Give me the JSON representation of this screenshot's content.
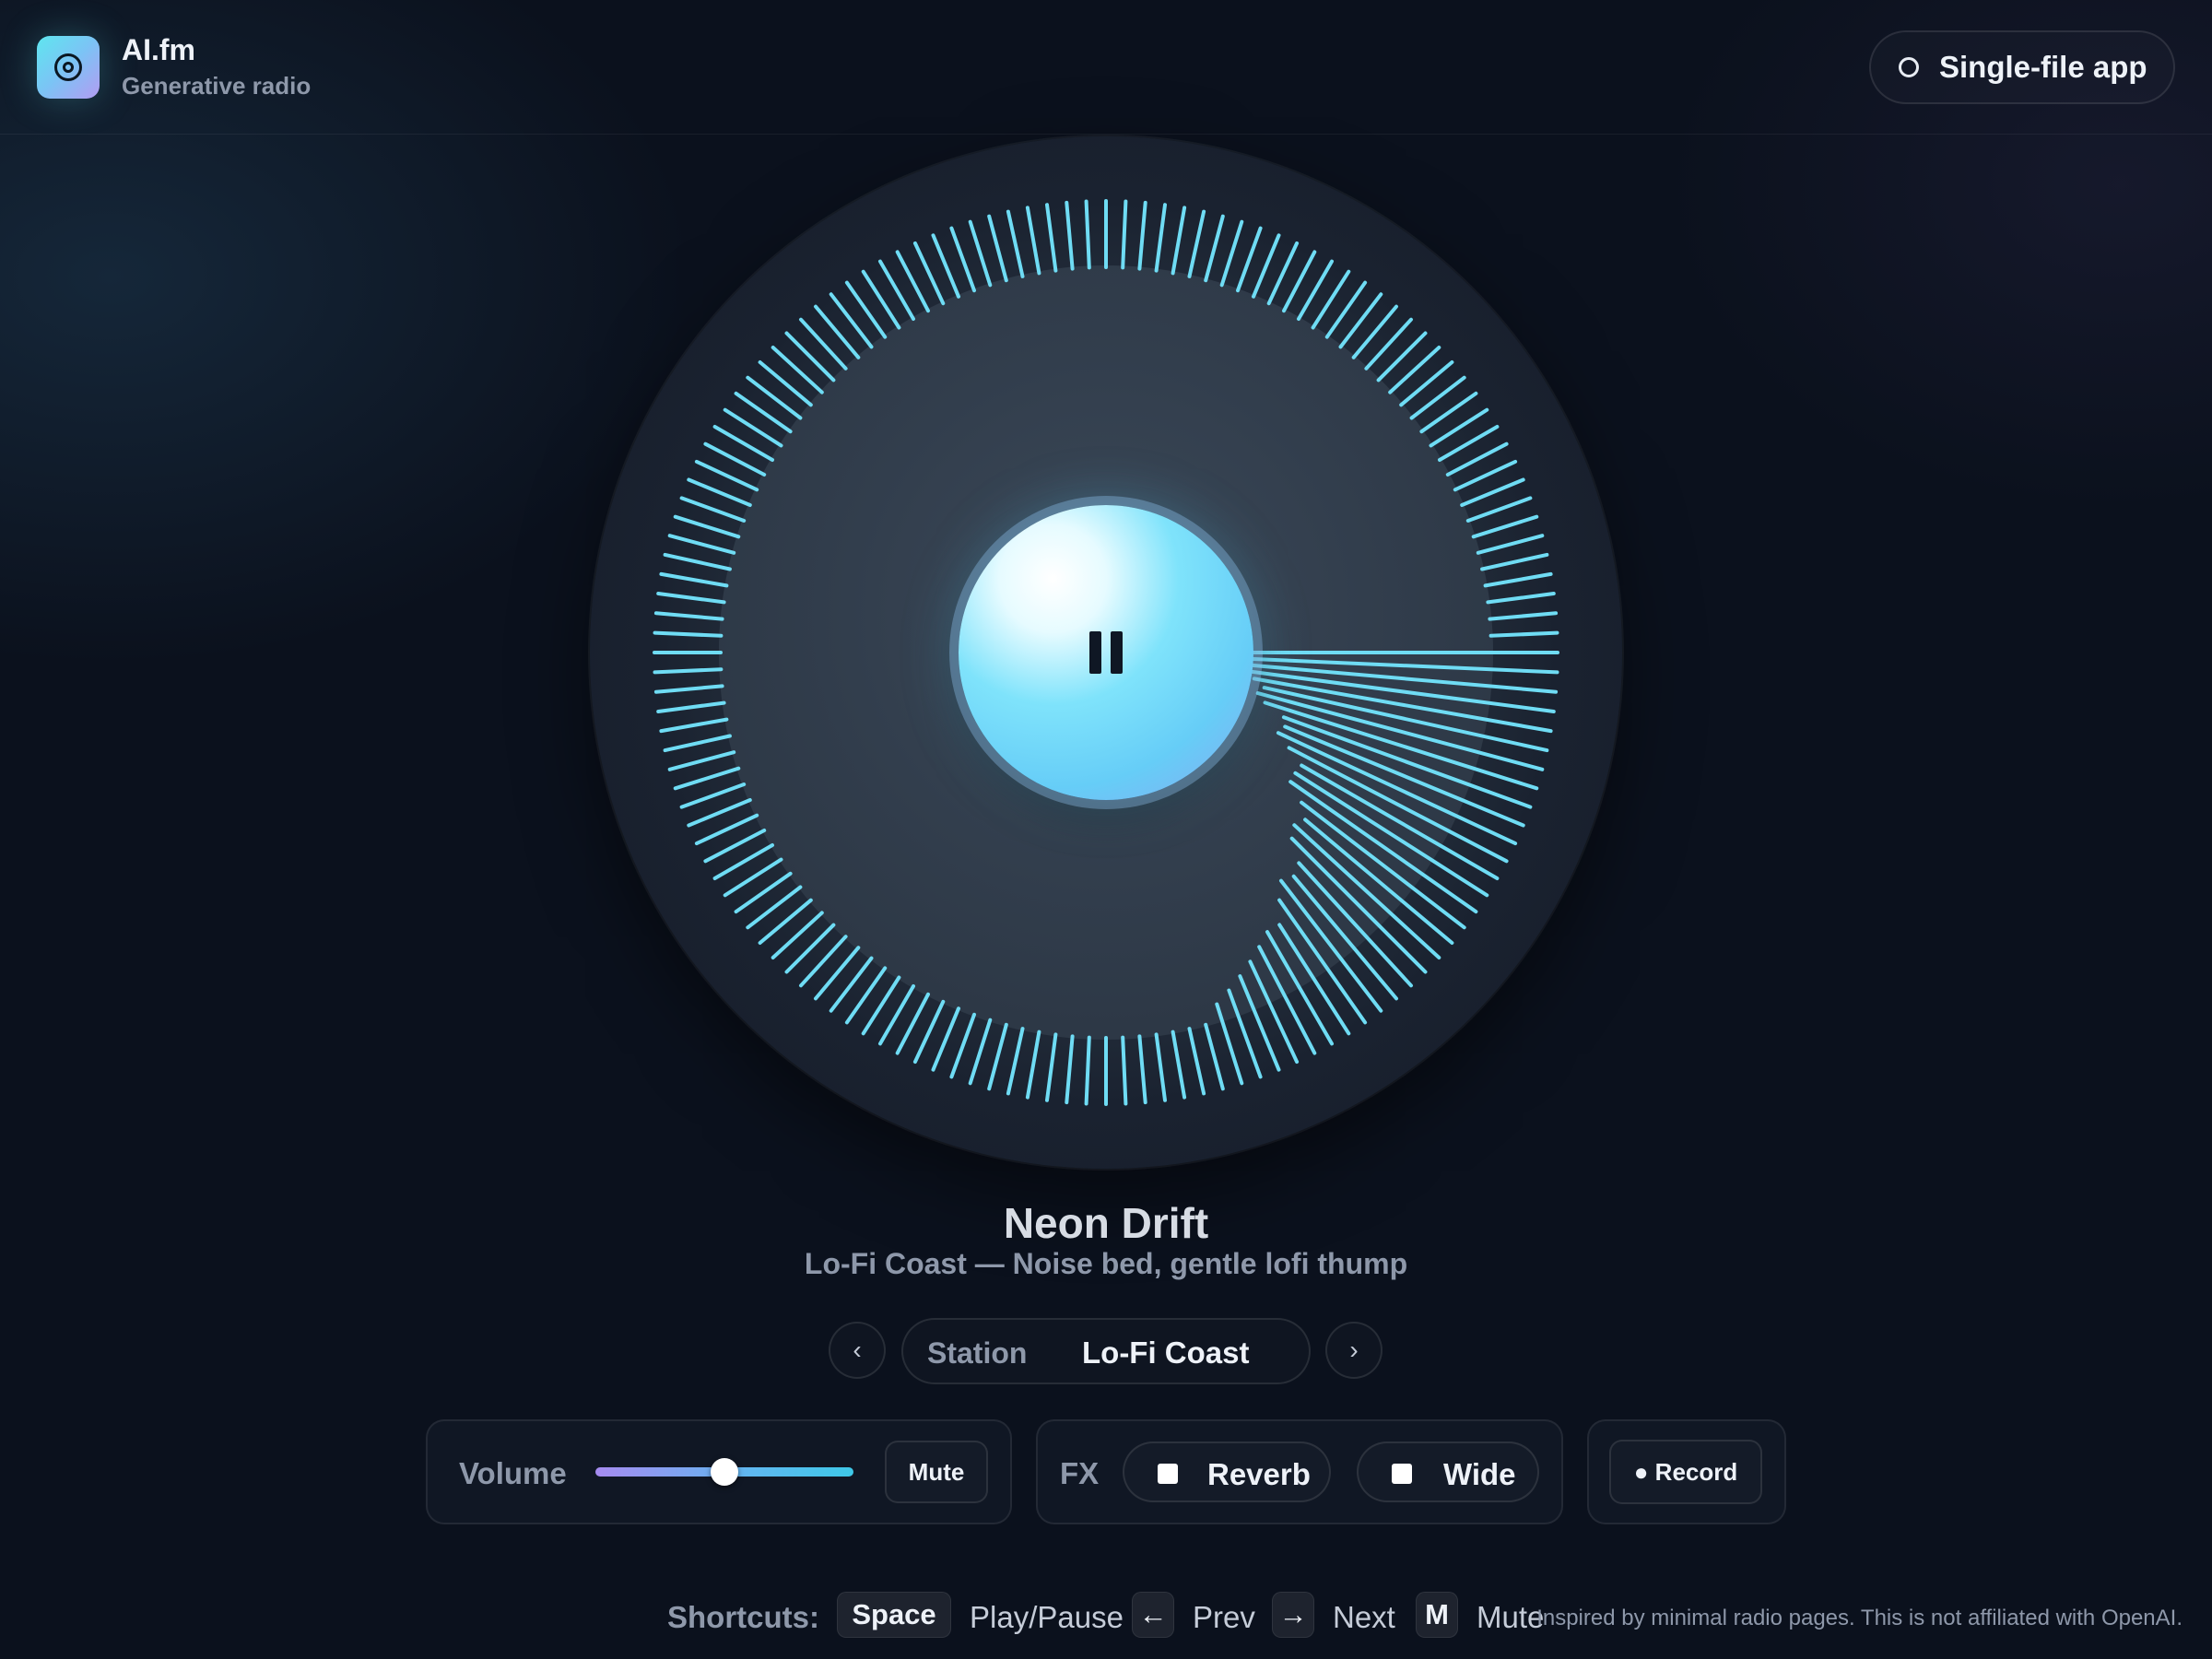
{
  "brand": {
    "name": "AI.fm",
    "subtitle": "Generative radio",
    "logo_icon": "radio-waves-icon"
  },
  "top_pill": {
    "label": "Single-file app",
    "icon": "circle-icon"
  },
  "player": {
    "state": "playing",
    "button_icon": "pause-icon",
    "track_title": "Neon Drift",
    "track_subtitle": "Lo-Fi Coast — Noise bed, gentle lofi thump"
  },
  "station": {
    "label": "Station",
    "value": "Lo-Fi Coast",
    "prev_glyph": "‹",
    "next_glyph": "›"
  },
  "volume": {
    "label": "Volume",
    "level": 0.5,
    "mute_label": "Mute"
  },
  "fx": {
    "label": "FX",
    "options": [
      {
        "label": "Reverb",
        "checked": false
      },
      {
        "label": "Wide",
        "checked": false
      }
    ]
  },
  "record": {
    "label": "● Record"
  },
  "shortcuts": {
    "heading": "Shortcuts:",
    "items": [
      {
        "key": "Space",
        "action": "Play/Pause"
      },
      {
        "key": "←",
        "action": "Prev"
      },
      {
        "key": "→",
        "action": "Next"
      },
      {
        "key": "M",
        "action": "Mute"
      }
    ]
  },
  "footer": {
    "note": "Inspired by minimal radio pages. This is not affiliated with OpenAI."
  },
  "colors": {
    "background": "#0b111d",
    "accent_cyan": "#5ee6ef",
    "tick_color": "#6fdcf4",
    "accent_violet": "#a68bf0"
  }
}
